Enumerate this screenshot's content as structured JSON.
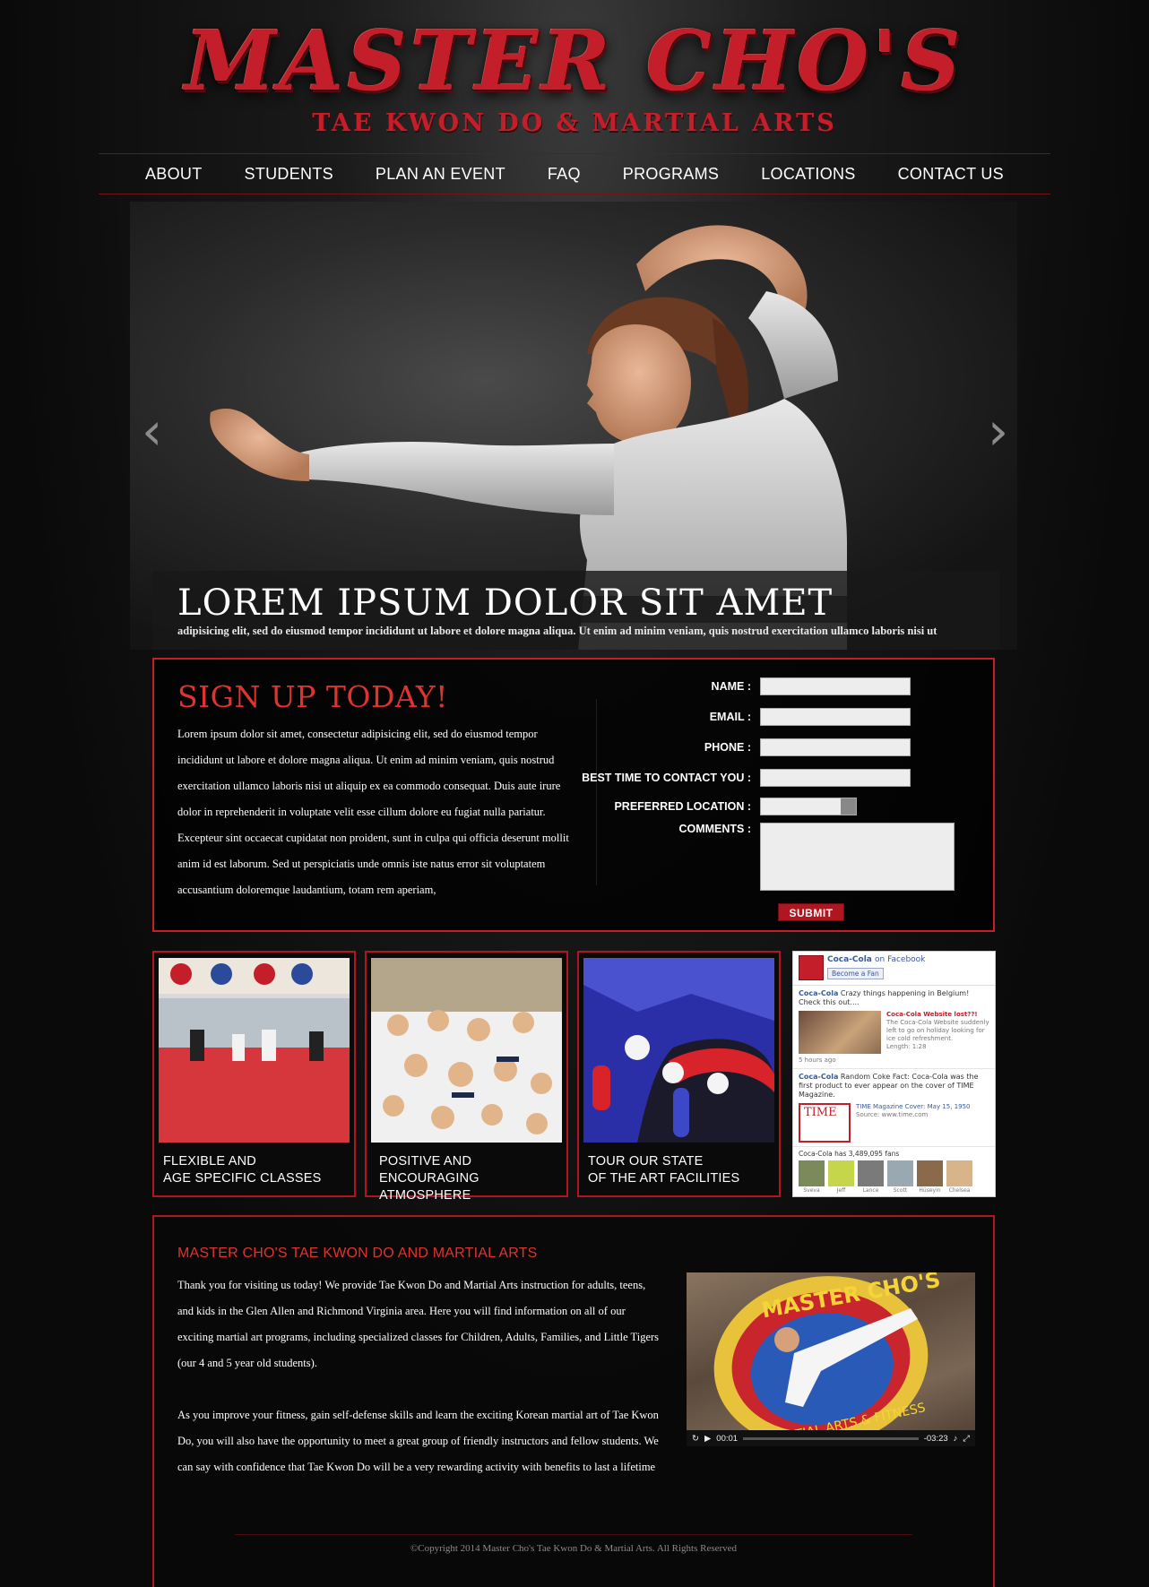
{
  "brand": {
    "name": "MASTER CHO'S",
    "tagline": "TAE KWON DO & MARTIAL ARTS",
    "accent": "#c41e2a"
  },
  "nav": {
    "items": [
      "ABOUT",
      "STUDENTS",
      "PLAN AN EVENT",
      "FAQ",
      "PROGRAMS",
      "LOCATIONS",
      "CONTACT US"
    ]
  },
  "hero": {
    "title": "LOREM IPSUM DOLOR SIT AMET",
    "subtitle": "adipisicing elit, sed do eiusmod tempor incididunt ut labore et dolore magna aliqua. Ut enim ad minim veniam, quis nostrud exercitation ullamco laboris nisi ut",
    "prev_icon": "chevron-left-icon",
    "next_icon": "chevron-right-icon"
  },
  "signup": {
    "title": "SIGN UP TODAY!",
    "text": "Lorem ipsum dolor sit amet, consectetur adipisicing elit, sed do eiusmod tempor incididunt ut labore et dolore magna aliqua. Ut enim ad minim veniam, quis nostrud exercitation ullamco laboris nisi ut aliquip ex ea commodo consequat. Duis aute irure dolor in reprehenderit in voluptate velit esse cillum dolore eu fugiat nulla pariatur. Excepteur sint occaecat cupidatat non proident, sunt in culpa qui officia deserunt mollit anim id est laborum. Sed ut perspiciatis unde omnis iste natus error sit voluptatem accusantium doloremque laudantium, totam rem aperiam,",
    "labels": {
      "name": "NAME :",
      "email": "EMAIL :",
      "phone": "PHONE :",
      "best_time": "BEST TIME TO CONTACT YOU :",
      "location": "PREFERRED LOCATION :",
      "comments": "COMMENTS :"
    },
    "submit": "SUBMIT"
  },
  "tiles": [
    {
      "line1": "FLEXIBLE AND",
      "line2": "AGE SPECIFIC CLASSES"
    },
    {
      "line1": "POSITIVE AND",
      "line2": "ENCOURAGING ATMOSPHERE"
    },
    {
      "line1": "TOUR OUR STATE",
      "line2": "OF THE ART FACILITIES"
    }
  ],
  "facebook": {
    "page": "Coca-Cola",
    "on": "on Facebook",
    "fan_button": "Become a Fan",
    "post1_author": "Coca-Cola",
    "post1_text": "Crazy things happening in Belgium! Check this out....",
    "post1_link": "Coca-Cola Website lost??!",
    "post1_desc": "The Coca-Cola Website suddenly left to go on holiday looking for ice cold refreshment.",
    "post1_length": "Length: 1:28",
    "post1_time": "5 hours ago",
    "post2_author": "Coca-Cola",
    "post2_text": "Random Coke Fact: Coca-Cola was the first product to ever appear on the cover of TIME Magazine.",
    "post2_thumb": "TIME",
    "post2_link": "TIME Magazine Cover: May 15, 1950",
    "post2_source": "Source: www.time.com",
    "fans": "Coca-Cola has 3,489,095 fans",
    "fan_names": [
      "Sveva",
      "Jeff",
      "Lance",
      "Scott",
      "Hüseyin",
      "Chelsea"
    ]
  },
  "about": {
    "title": "MASTER CHO'S TAE KWON DO AND MARTIAL ARTS",
    "para1": "Thank you for visiting us today! We provide Tae Kwon Do and Martial Arts instruction for adults, teens, and kids in the Glen Allen and Richmond Virginia area. Here you will find information on all of our exciting martial art programs, including specialized classes for Children, Adults, Families, and Little Tigers (our 4 and 5 year old students).",
    "para2": "As you improve your fitness, gain self-defense skills and learn the exciting Korean martial art of Tae Kwon Do, you will also have the opportunity to meet a great group of friendly instructors and fellow students. We can say with confidence that Tae Kwon Do will be a very rewarding activity with benefits to last a lifetime"
  },
  "video": {
    "sign_top": "MASTER CHO'S",
    "sign_bottom": "MARTIAL ARTS & FITNESS",
    "time_elapsed": "00:01",
    "time_remaining": "-03:23"
  },
  "footer": {
    "copyright": "©Copyright 2014 Master Cho's Tae Kwon Do & Martial Arts. All Rights Reserved"
  }
}
